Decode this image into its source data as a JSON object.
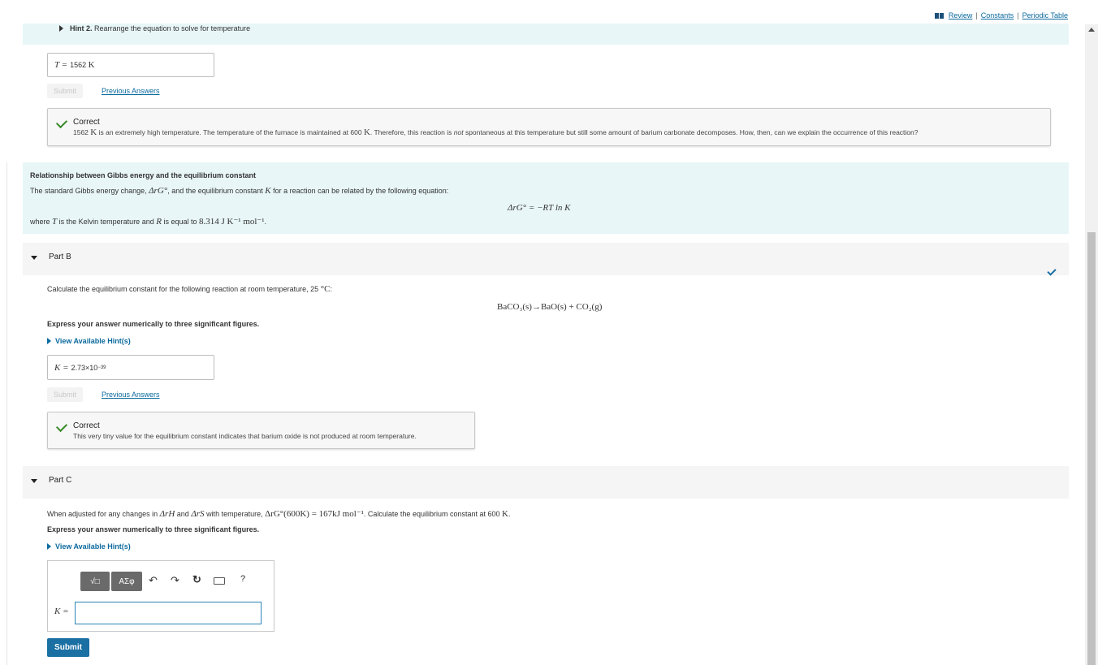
{
  "toplinks": {
    "review": "Review",
    "constants": "Constants",
    "periodic": "Periodic Table",
    "sep": "|"
  },
  "hint2": {
    "label": "Hint 2.",
    "text": "Rearrange the equation to solve for temperature"
  },
  "partA": {
    "answer_label": "T =",
    "answer_value": "1562",
    "answer_unit": "K",
    "submit": "Submit",
    "previous": "Previous Answers",
    "feedback_title": "Correct",
    "feedback_1562": "1562",
    "feedback_unit": "K",
    "feedback_a": " is an extremely high temperature. The temperature of the furnace is maintained at 600 ",
    "feedback_b": ". Therefore, this reaction is ",
    "feedback_not": "not",
    "feedback_c": " spontaneous at this temperature but still some amount of barium carbonate decomposes. How, then, can we explain the occurrence of this reaction?"
  },
  "relationship": {
    "title": "Relationship between Gibbs energy and the equilibrium constant",
    "intro_a": "The standard Gibbs energy change, ",
    "intro_b": ", and the equilibrium constant ",
    "intro_c": " for a reaction can be related by the following equation:",
    "equation": "ΔrG° = −RT ln K",
    "where_a": "where ",
    "where_b": " is the Kelvin temperature and ",
    "where_c": " is equal to ",
    "r_value": "8.314 J K⁻¹ mol⁻¹",
    "where_d": "."
  },
  "partB": {
    "label": "Part B",
    "question": "Calculate the equilibrium constant for the following reaction at room temperature, 25 ",
    "question_unit": "°C",
    "question_end": ":",
    "reaction": "BaCO₃(s)→BaO(s) + CO₂(g)",
    "instruction": "Express your answer numerically to three significant figures.",
    "hints": "View Available Hint(s)",
    "answer_label": "K =",
    "answer_value": "2.73×10",
    "answer_exp": "−39",
    "submit": "Submit",
    "previous": "Previous Answers",
    "feedback_title": "Correct",
    "feedback_text": "This very tiny value for the equilibrium constant indicates that barium oxide is not produced at room temperature."
  },
  "partC": {
    "label": "Part C",
    "question_a": "When adjusted for any changes in ",
    "question_and": " and ",
    "question_b": " with temperature, ",
    "gibbs_600": "ΔrG°(600K) = 167kJ mol⁻¹",
    "question_c": ". Calculate the equilibrium constant at 600 ",
    "question_unit": "K",
    "question_end": ".",
    "instruction": "Express your answer numerically to three significant figures.",
    "hints": "View Available Hint(s)",
    "toolbar_templates": "√□",
    "toolbar_greek": "ΑΣφ",
    "help": "?",
    "answer_label": "K =",
    "answer_value": "",
    "submit": "Submit"
  },
  "symbols": {
    "drG": "ΔrG°",
    "K": "K",
    "T": "T",
    "R": "R",
    "drH": "ΔrH",
    "drS": "ΔrS"
  }
}
